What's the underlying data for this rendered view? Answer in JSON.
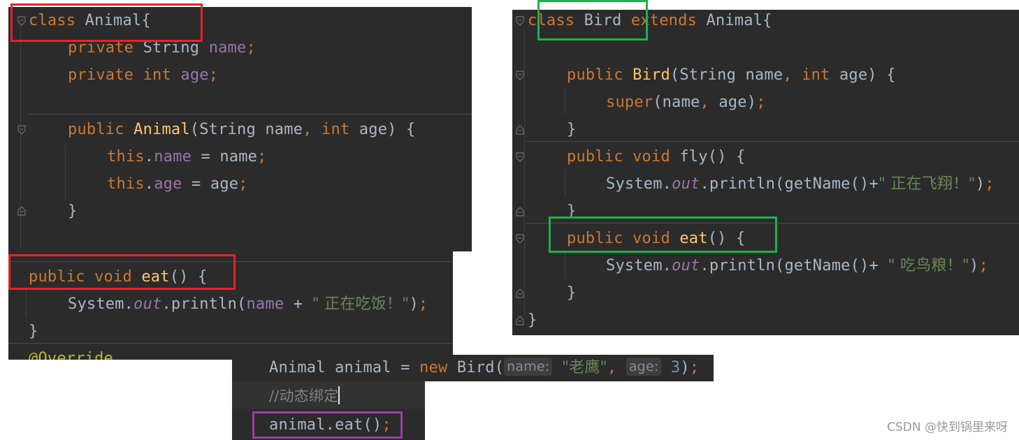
{
  "animal_panel": {
    "l1_kw": "class",
    "l1_name": " Animal{",
    "l2_kw": "private",
    "l2_type": " String ",
    "l2_field": "name",
    "l2_semi": ";",
    "l3_kw1": "private",
    "l3_kw2": "int",
    "l3_field": "age",
    "l3_semi": ";",
    "l5_kw": "public",
    "l5_fn": "Animal",
    "l5_p1": "(String name",
    "l5_comma": ",",
    "l5_int": "int",
    "l5_p2": " age) {",
    "l6_this": "this",
    "l6_dot": ".",
    "l6_field": "name",
    "l6_rest": " = name",
    "l6_semi": ";",
    "l7_this": "this",
    "l7_dot": ".",
    "l7_field": "age",
    "l7_rest": " = age",
    "l7_semi": ";",
    "l8_brace": "}"
  },
  "eat_panel": {
    "l1_kw": "public void",
    "l1_fn": "eat",
    "l1_rest": "() {",
    "l2_sys": "System.",
    "l2_out": "out",
    "l2_println": ".println(",
    "l2_field": "name",
    "l2_plus": " + ",
    "l2_str": "\" 正在吃饭！\"",
    "l2_close": ")",
    "l2_semi": ";",
    "l3_brace": "}",
    "l4_annotation": "@Override"
  },
  "bird_panel": {
    "l1_kw": "class",
    "l1_name": " Bird ",
    "l1_ext": "extends",
    "l1_parent": " Animal{",
    "l3_kw": "public",
    "l3_fn": "Bird",
    "l3_p1": "(String name",
    "l3_comma": ",",
    "l3_int": "int",
    "l3_p2": " age) {",
    "l4_super": "super",
    "l4_args": "(name",
    "l4_comma": ",",
    "l4_args2": " age)",
    "l4_semi": ";",
    "l5_brace": "}",
    "l6_kw": "public void",
    "l6_fn": "fly",
    "l6_rest": "() {",
    "l7_sys": "System.",
    "l7_out": "out",
    "l7_println": ".println(getName()+",
    "l7_str": "\" 正在飞翔！\"",
    "l7_close": ")",
    "l7_semi": ";",
    "l8_brace": "}",
    "l9_kw": "public void",
    "l9_fn": "eat",
    "l9_rest": "() {",
    "l10_sys": "System.",
    "l10_out": "out",
    "l10_println": ".println(getName()+ ",
    "l10_str": "\" 吃鸟粮！\"",
    "l10_close": ")",
    "l10_semi": ";",
    "l11_brace": "}",
    "l12_brace": "}"
  },
  "binding_panel": {
    "l1_type": "Animal animal = ",
    "l1_new": "new",
    "l1_ctor": " Bird(",
    "l1_hint_name": "name:",
    "l1_str": "\"老鹰\"",
    "l1_comma": ",",
    "l1_hint_age": "age:",
    "l1_num": "3",
    "l1_close": ")",
    "l1_semi": ";",
    "l2_comment": "//动态绑定",
    "l3_call": "animal.eat()",
    "l3_semi": ";"
  },
  "watermark": "CSDN @快到锅里来呀",
  "colors": {
    "red_box": "#e5232d",
    "green_box": "#1fb04a",
    "purple_box": "#9b3fa6",
    "editor_bg": "#2b2b2b"
  }
}
